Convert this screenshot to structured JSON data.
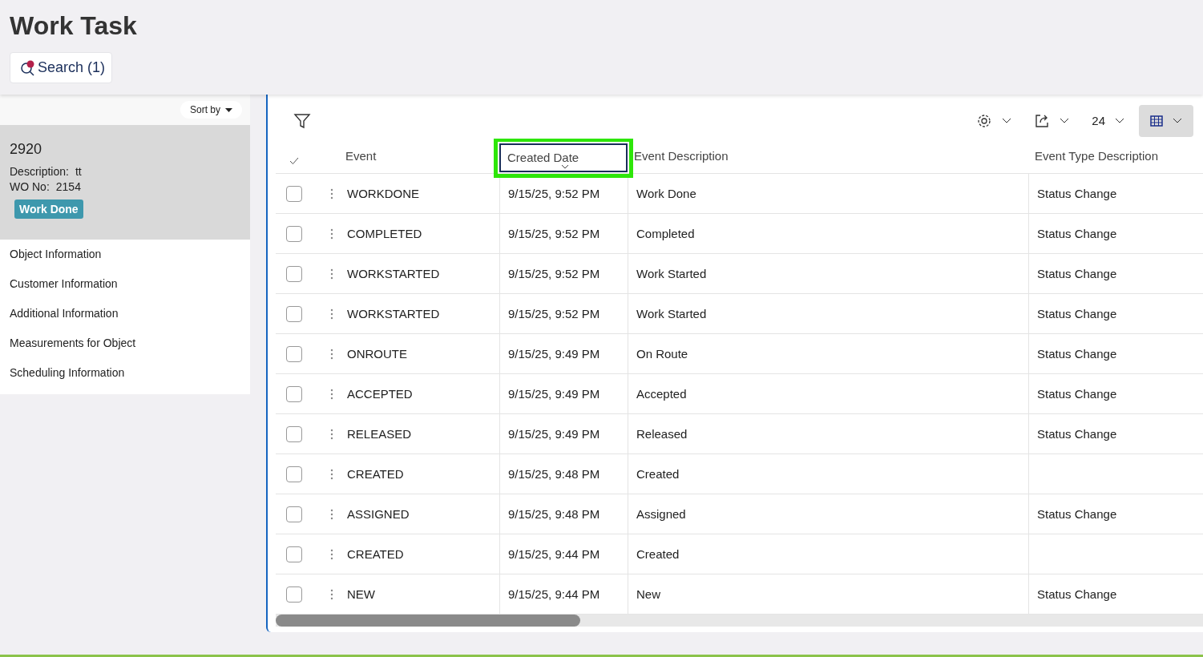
{
  "page": {
    "title": "Work Task",
    "search_button": "Search (1)",
    "search_active": true
  },
  "sidebar": {
    "sort_label": "Sort by",
    "record": {
      "id": "2920",
      "fields": [
        {
          "label": "Description:",
          "value": "tt"
        },
        {
          "label": "WO No:",
          "value": "2154"
        }
      ],
      "status": "Work Done",
      "selected": true
    },
    "items": [
      "Object Information",
      "Customer Information",
      "Additional Information",
      "Measurements for Object",
      "Scheduling Information"
    ]
  },
  "toolbar": {
    "page_size": "24"
  },
  "table": {
    "columns": [
      {
        "label": "Event",
        "highlighted": false
      },
      {
        "label": "Created Date",
        "highlighted": true
      },
      {
        "label": "Event Description",
        "highlighted": false
      },
      {
        "label": "Event Type Description",
        "highlighted": false
      }
    ],
    "rows": [
      {
        "checked": false,
        "cells": [
          "WORKDONE",
          "9/15/25, 9:52 PM",
          "Work Done",
          "Status Change"
        ]
      },
      {
        "checked": false,
        "cells": [
          "COMPLETED",
          "9/15/25, 9:52 PM",
          "Completed",
          "Status Change"
        ]
      },
      {
        "checked": false,
        "cells": [
          "WORKSTARTED",
          "9/15/25, 9:52 PM",
          "Work Started",
          "Status Change"
        ]
      },
      {
        "checked": false,
        "cells": [
          "WORKSTARTED",
          "9/15/25, 9:52 PM",
          "Work Started",
          "Status Change"
        ]
      },
      {
        "checked": false,
        "cells": [
          "ONROUTE",
          "9/15/25, 9:49 PM",
          "On Route",
          "Status Change"
        ]
      },
      {
        "checked": false,
        "cells": [
          "ACCEPTED",
          "9/15/25, 9:49 PM",
          "Accepted",
          "Status Change"
        ]
      },
      {
        "checked": false,
        "cells": [
          "RELEASED",
          "9/15/25, 9:49 PM",
          "Released",
          "Status Change"
        ]
      },
      {
        "checked": false,
        "cells": [
          "CREATED",
          "9/15/25, 9:48 PM",
          "Created",
          ""
        ]
      },
      {
        "checked": false,
        "cells": [
          "ASSIGNED",
          "9/15/25, 9:48 PM",
          "Assigned",
          "Status Change"
        ]
      },
      {
        "checked": false,
        "cells": [
          "CREATED",
          "9/15/25, 9:44 PM",
          "Created",
          ""
        ]
      },
      {
        "checked": false,
        "cells": [
          "NEW",
          "9/15/25, 9:44 PM",
          "New",
          "Status Change"
        ]
      }
    ]
  }
}
